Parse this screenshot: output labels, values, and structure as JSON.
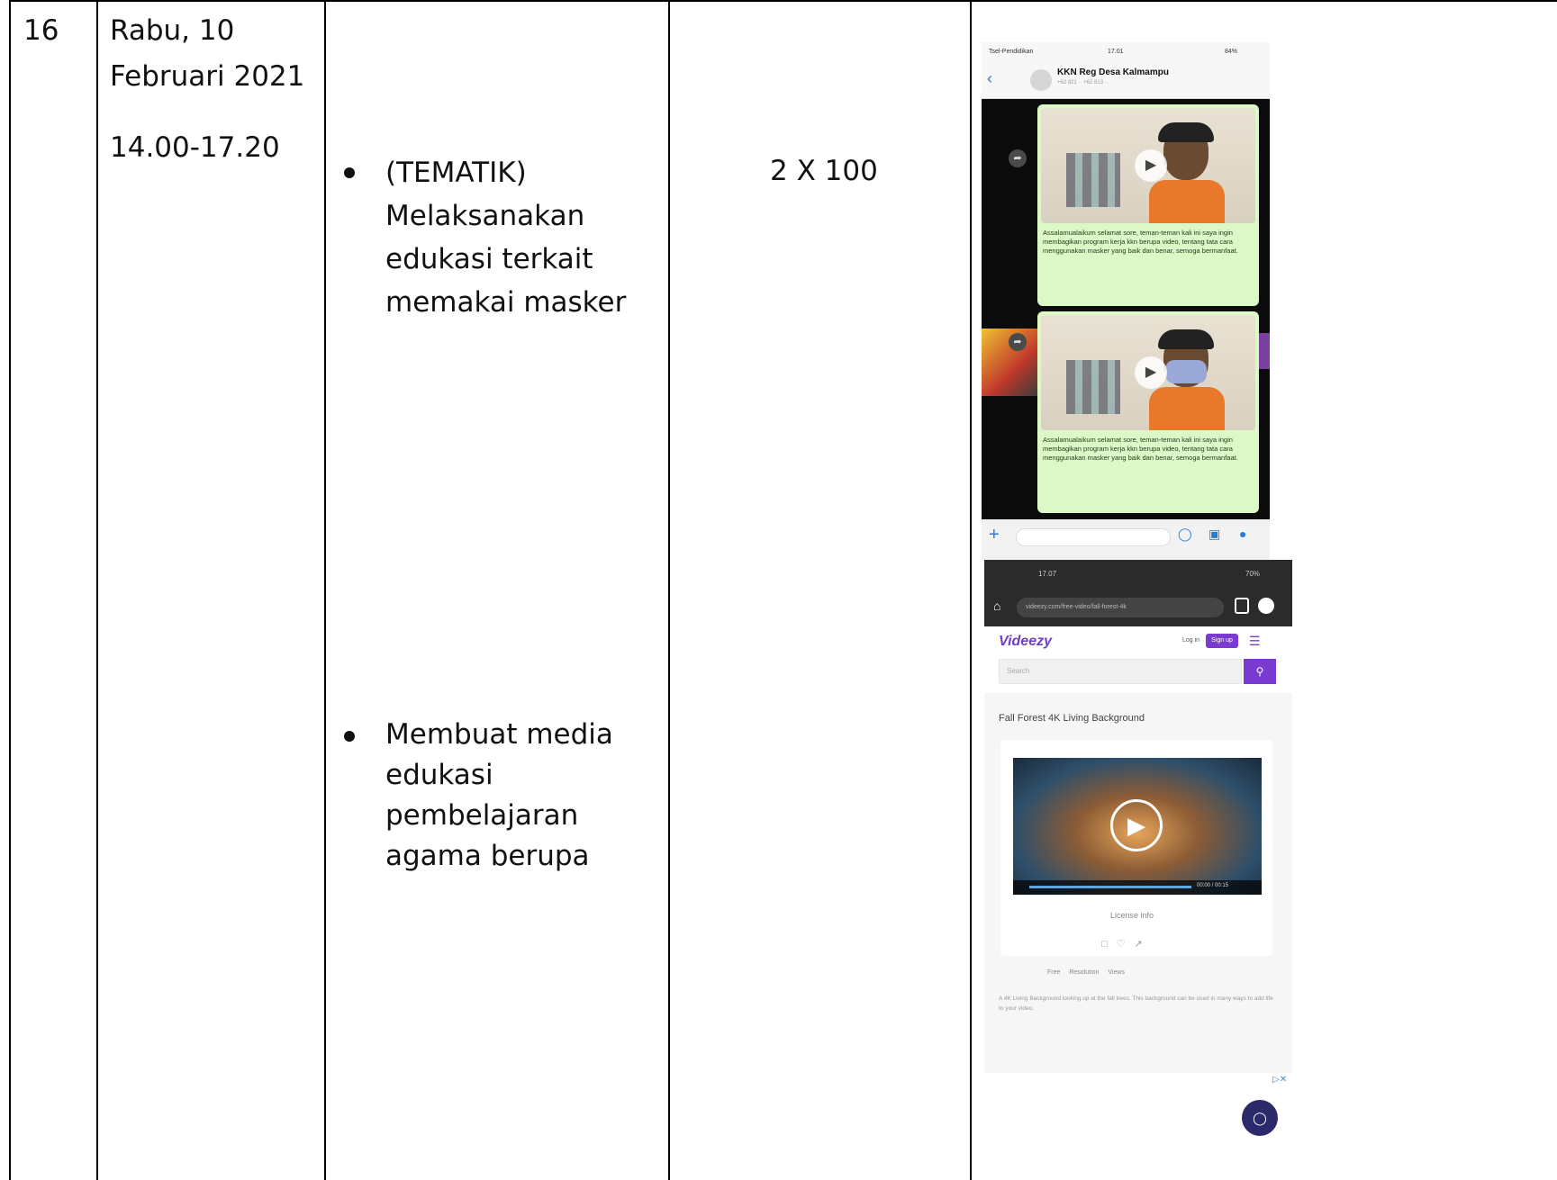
{
  "row": {
    "number": "16",
    "date_line1": "Rabu, 10",
    "date_line2": "Februari 2021",
    "time": "14.00-17.20",
    "activities": [
      "(TEMATIK) Melaksanakan edukasi terkait memakai masker",
      "Membuat media edukasi pembelajaran agama berupa"
    ],
    "duration": "2 X 100"
  },
  "whatsapp": {
    "carrier": "Tsel-Pendidikan",
    "clock": "17.01",
    "battery": "84%",
    "group_name": "KKN Reg Desa Kalmampu",
    "caption": "Assalamualaikum selamat sore, teman-teman kali ini saya ingin membagikan program kerja kkn berupa video, tentang tata cara menggunakan masker yang baik dan benar, semoga bermanfaat."
  },
  "videezy": {
    "clock": "17.07",
    "battery": "70%",
    "url": "videezy.com/free-video/fall-forest-4k",
    "logo": "Videezy",
    "login": "Log in",
    "signup": "Sign up",
    "search_placeholder": "Search",
    "video_title": "Fall Forest 4K Living Background",
    "time": "00:00 / 00:15",
    "license": "License info",
    "meta": "Free  Resolution  Views",
    "description": "A 4K Living Background looking up at the fall trees. This background can be used in many ways to add life to your video."
  }
}
